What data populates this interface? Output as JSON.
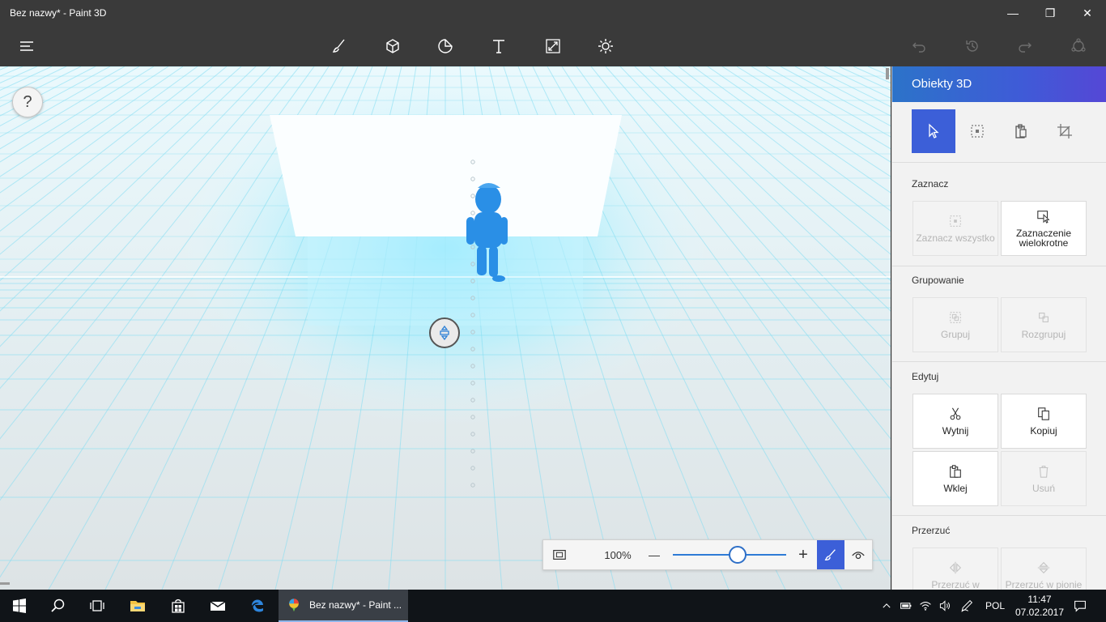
{
  "window": {
    "title": "Bez nazwy* - Paint 3D",
    "minimize": "—",
    "maximize": "❐",
    "close": "✕"
  },
  "toolbar": {
    "tools": [
      "brush-icon",
      "cube-icon",
      "sticker-icon",
      "text-icon",
      "canvas-resize-icon",
      "effects-sun-icon"
    ]
  },
  "canvas": {
    "help": "?"
  },
  "zoom": {
    "value": "100%",
    "minus": "—",
    "plus": "+",
    "level": 0.5
  },
  "panel": {
    "title": "Obiekty 3D",
    "sections": {
      "select": {
        "label": "Zaznacz",
        "select_all": "Zaznacz wszystko",
        "multi_select": "Zaznaczenie wielokrotne"
      },
      "group": {
        "label": "Grupowanie",
        "group": "Grupuj",
        "ungroup": "Rozgrupuj"
      },
      "edit": {
        "label": "Edytuj",
        "cut": "Wytnij",
        "copy": "Kopiuj",
        "paste": "Wklej",
        "delete": "Usuń"
      },
      "flip": {
        "label": "Przerzuć",
        "flip_h": "Przerzuć w",
        "flip_v": "Przerzuć w pionie"
      }
    }
  },
  "taskbar": {
    "app_label": "Bez nazwy* - Paint ...",
    "language": "POL",
    "time": "11:47",
    "date": "07.02.2017"
  },
  "colors": {
    "accent": "#3c5fd8",
    "titlebar": "#3a3a3a",
    "taskbar": "#101418",
    "model": "#2a8fe6"
  }
}
